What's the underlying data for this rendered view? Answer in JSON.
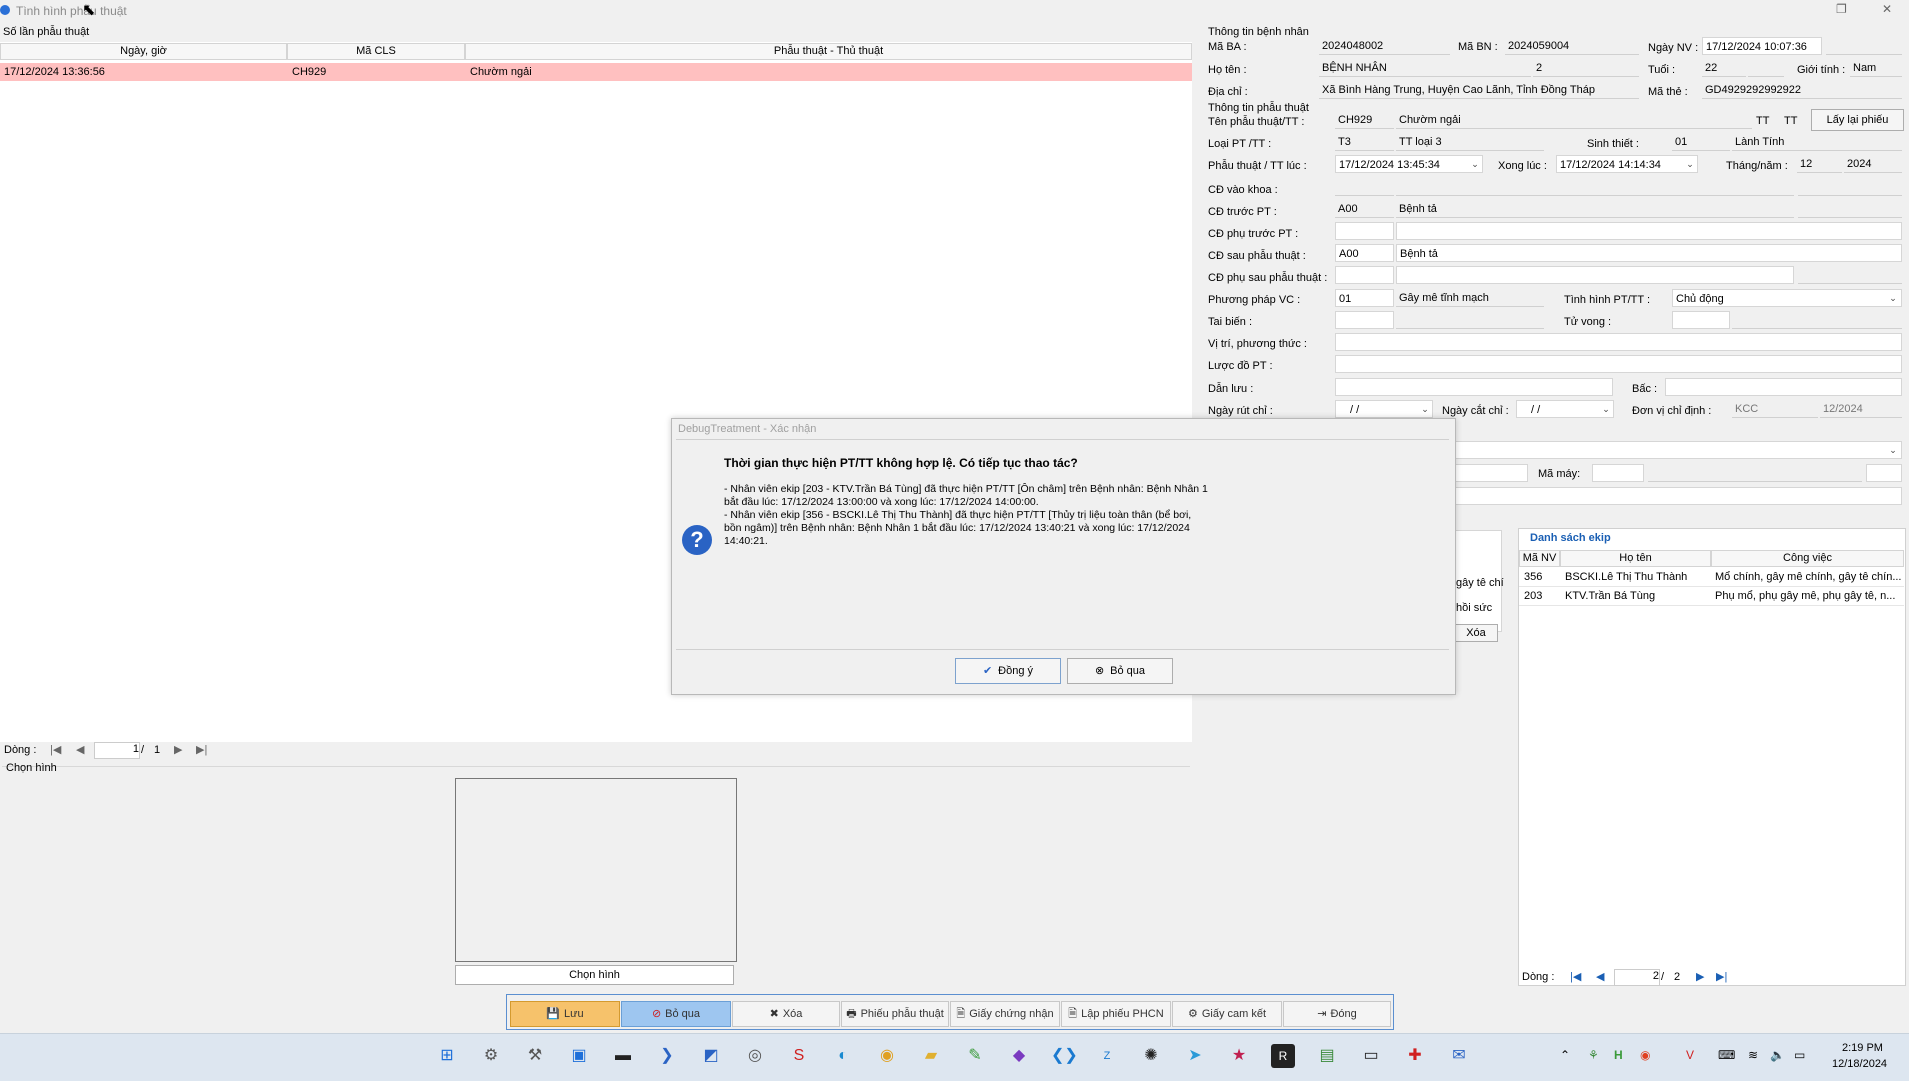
{
  "window": {
    "title": "Tình hình phẫu thuật"
  },
  "left_panel": {
    "group_label": "Số lần phẫu thuật",
    "columns": [
      "Ngày, giờ",
      "Mã CLS",
      "Phẫu thuật - Thủ thuật"
    ],
    "rows": [
      {
        "date": "17/12/2024 13:36:56",
        "code": "CH929",
        "name": "Chườm ngải"
      }
    ],
    "pager": {
      "label": "Dòng :",
      "current": "1",
      "sep": "/",
      "total": "1"
    },
    "image_group": "Chọn hình",
    "image_button": "Chọn hình"
  },
  "patient": {
    "section": "Thông tin bệnh nhân",
    "ma_ba_label": "Mã BA :",
    "ma_ba": "2024048002",
    "ma_bn_label": "Mã BN :",
    "ma_bn": "2024059004",
    "ngay_nv_label": "Ngày NV :",
    "ngay_nv": "17/12/2024 10:07:36",
    "ho_ten_label": "Họ tên :",
    "ho_ten": "BỆNH NHÂN",
    "ho_ten_2": "2",
    "tuoi_label": "Tuổi :",
    "tuoi": "22",
    "gioi_tinh_label": "Giới tính :",
    "gioi_tinh": "Nam",
    "dia_chi_label": "Địa chỉ :",
    "dia_chi": "Xã Bình Hàng Trung, Huyện Cao Lãnh, Tỉnh Đồng Tháp",
    "ma_the_label": "Mã thẻ :",
    "ma_the": "GD4929292992922"
  },
  "surgery": {
    "section": "Thông tin phẫu thuật",
    "ten_pt_label": "Tên phẫu thuật/TT :",
    "ten_pt_code": "CH929",
    "ten_pt_name": "Chườm ngải",
    "tt1": "TT",
    "tt2": "TT",
    "reload_button": "Lấy lại phiếu",
    "loai_label": "Loại PT /TT :",
    "loai_code": "T3",
    "loai_name": "TT loại 3",
    "sinh_thiet_label": "Sinh thiết :",
    "sinh_thiet_code": "01",
    "sinh_thiet_name": "Lành Tính",
    "pt_luc_label": "Phẫu thuật / TT lúc :",
    "pt_luc": "17/12/2024 13:45:34",
    "xong_luc_label": "Xong lúc :",
    "xong_luc": "17/12/2024 14:14:34",
    "thang_nam_label": "Tháng/năm :",
    "thang": "12",
    "nam": "2024",
    "cd_vao_khoa_label": "CĐ vào khoa :",
    "cd_truoc_label": "CĐ trước PT :",
    "cd_truoc_code": "A00",
    "cd_truoc_name": "Bệnh tả",
    "cd_phu_truoc_label": "CĐ phụ trước PT :",
    "cd_sau_label": "CĐ sau phẫu thuật :",
    "cd_sau_code": "A00",
    "cd_sau_name": "Bệnh tả",
    "cd_phu_sau_label": "CĐ phụ sau phẫu thuật :",
    "phuong_phap_label": "Phương pháp VC :",
    "phuong_phap_code": "01",
    "phuong_phap_name": "Gây mê tĩnh mạch",
    "tinh_hinh_label": "Tình hình PT/TT :",
    "tinh_hinh": "Chủ động",
    "tai_bien_label": "Tai biến :",
    "tu_vong_label": "Tử vong :",
    "vi_tri_label": "Vị trí, phương thức :",
    "luoc_do_label": "Lược đồ PT :",
    "dan_luu_label": "Dẫn lưu :",
    "bac_label": "Bấc :",
    "ngay_rut_chi_label": "Ngày rút chỉ :",
    "ngay_rut_chi": "/   /",
    "ngay_cat_chi_label": "Ngày cắt chỉ :",
    "ngay_cat_chi": "/   /",
    "don_vi_label": "Đơn vị chỉ định :",
    "don_vi": "KCC",
    "don_vi_date": "12/2024",
    "ma_may_label": "Mã máy:",
    "partial_1": "gây tê chí",
    "partial_2": "hồi sức",
    "partial_3": "Xóa"
  },
  "ekip": {
    "title": "Danh sách ekip",
    "columns": [
      "Mã NV",
      "Họ tên",
      "Công việc"
    ],
    "rows": [
      {
        "id": "356",
        "name": "BSCKI.Lê Thị Thu Thành",
        "job": "Mổ chính, gây mê chính, gây tê chín..."
      },
      {
        "id": "203",
        "name": "KTV.Trần Bá Tùng",
        "job": "Phụ mổ, phụ gây mê, phụ gây tê, n..."
      }
    ],
    "pager": {
      "label": "Dòng :",
      "current": "2",
      "sep": "/",
      "total": "2"
    }
  },
  "toolbar": {
    "save": "Lưu",
    "skip": "Bỏ qua",
    "delete": "Xóa",
    "form": "Phiếu phẫu thuật",
    "certificate": "Giấy chứng nhận",
    "phcn": "Lập phiếu PHCN",
    "commit": "Giấy cam kết",
    "close": "Đóng"
  },
  "dialog": {
    "title": "DebugTreatment - Xác nhận",
    "heading": "Thời gian thực hiện PT/TT không hợp lệ. Có tiếp tục thao tác?",
    "line1a": " - Nhân viên ekip [203 - KTV.Trần Bá Tùng] đã thực hiện PT/TT [Ôn châm] trên Bệnh nhân: Bệnh Nhân 1",
    "line1b": "bắt đầu lúc: 17/12/2024 13:00:00 và xong lúc: 17/12/2024 14:00:00.",
    "line2a": " - Nhân viên ekip [356 - BSCKI.Lê Thị Thu Thành] đã thực hiện PT/TT [Thủy trị liệu toàn thân (bể bơi,",
    "line2b": "bồn ngâm)] trên Bệnh nhân: Bệnh Nhân 1 bắt đầu lúc: 17/12/2024 13:40:21 và xong lúc: 17/12/2024",
    "line2c": "14:40:21.",
    "ok": "Đồng ý",
    "cancel": "Bỏ qua"
  },
  "taskbar": {
    "time": "2:19 PM",
    "date": "12/18/2024"
  }
}
